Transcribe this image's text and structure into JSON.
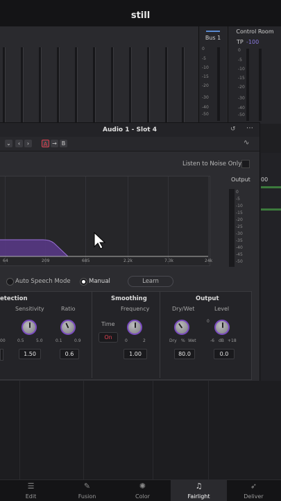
{
  "app": {
    "title": "still"
  },
  "meters": {
    "ticks": [
      "0",
      "-5",
      "-10",
      "-15",
      "-20",
      "-30",
      "-40",
      "-50"
    ]
  },
  "bus1": {
    "label": "Bus 1"
  },
  "control_room": {
    "label": "Control Room",
    "tp_label": "TP",
    "tp_value": "-100"
  },
  "plugin": {
    "title": "Audio 1 - Slot 4",
    "ab": {
      "a": "A",
      "arrow": "→",
      "b": "B"
    },
    "listen_label": "Listen to Noise Only",
    "output_label": "Output",
    "output_scale": [
      "0",
      "-5",
      "-10",
      "-15",
      "-20",
      "-25",
      "-30",
      "-35",
      "-40",
      "-45",
      "-50"
    ],
    "freq_labels": [
      "64",
      "209",
      "685",
      "2.2k",
      "7.3k",
      "24k"
    ],
    "modes": {
      "auto": "Auto Speech Mode",
      "manual": "Manual",
      "learn": "Learn",
      "selected": "Manual"
    },
    "sections": {
      "detection": {
        "title": "etection",
        "sensitivity_label": "Sensitivity",
        "sensitivity_min": "0.5",
        "sensitivity_max": "5.0",
        "sensitivity_value": "1.50",
        "ratio_label": "Ratio",
        "ratio_min": "0.1",
        "ratio_max": "0.9",
        "ratio_value": "0.6",
        "partial_label": "00"
      },
      "smoothing": {
        "title": "Smoothing",
        "time_label": "Time",
        "time_toggle": "On",
        "frequency_label": "Frequency",
        "frequency_min": "0",
        "frequency_max": "2",
        "frequency_value": "1.00"
      },
      "output": {
        "title": "Output",
        "drywet_label": "Dry/Wet",
        "drywet_min": "Dry",
        "drywet_mid": "%",
        "drywet_max": "Wet",
        "drywet_value": "80.0",
        "level_label": "Level",
        "level_zero": "0",
        "level_min": "-6",
        "level_mid": "dB",
        "level_max": "+18",
        "level_value": "0.0"
      }
    }
  },
  "side_value": "00",
  "tabs": [
    {
      "label": "Edit",
      "icon": "edit-icon"
    },
    {
      "label": "Fusion",
      "icon": "fusion-icon"
    },
    {
      "label": "Color",
      "icon": "color-icon"
    },
    {
      "label": "Fairlight",
      "icon": "fairlight-icon"
    },
    {
      "label": "Deliver",
      "icon": "deliver-icon"
    }
  ],
  "active_tab": "Fairlight",
  "colors": {
    "accent": "#7a4ac0",
    "toggle": "#e04050",
    "tp_value": "#8a7ae0"
  }
}
